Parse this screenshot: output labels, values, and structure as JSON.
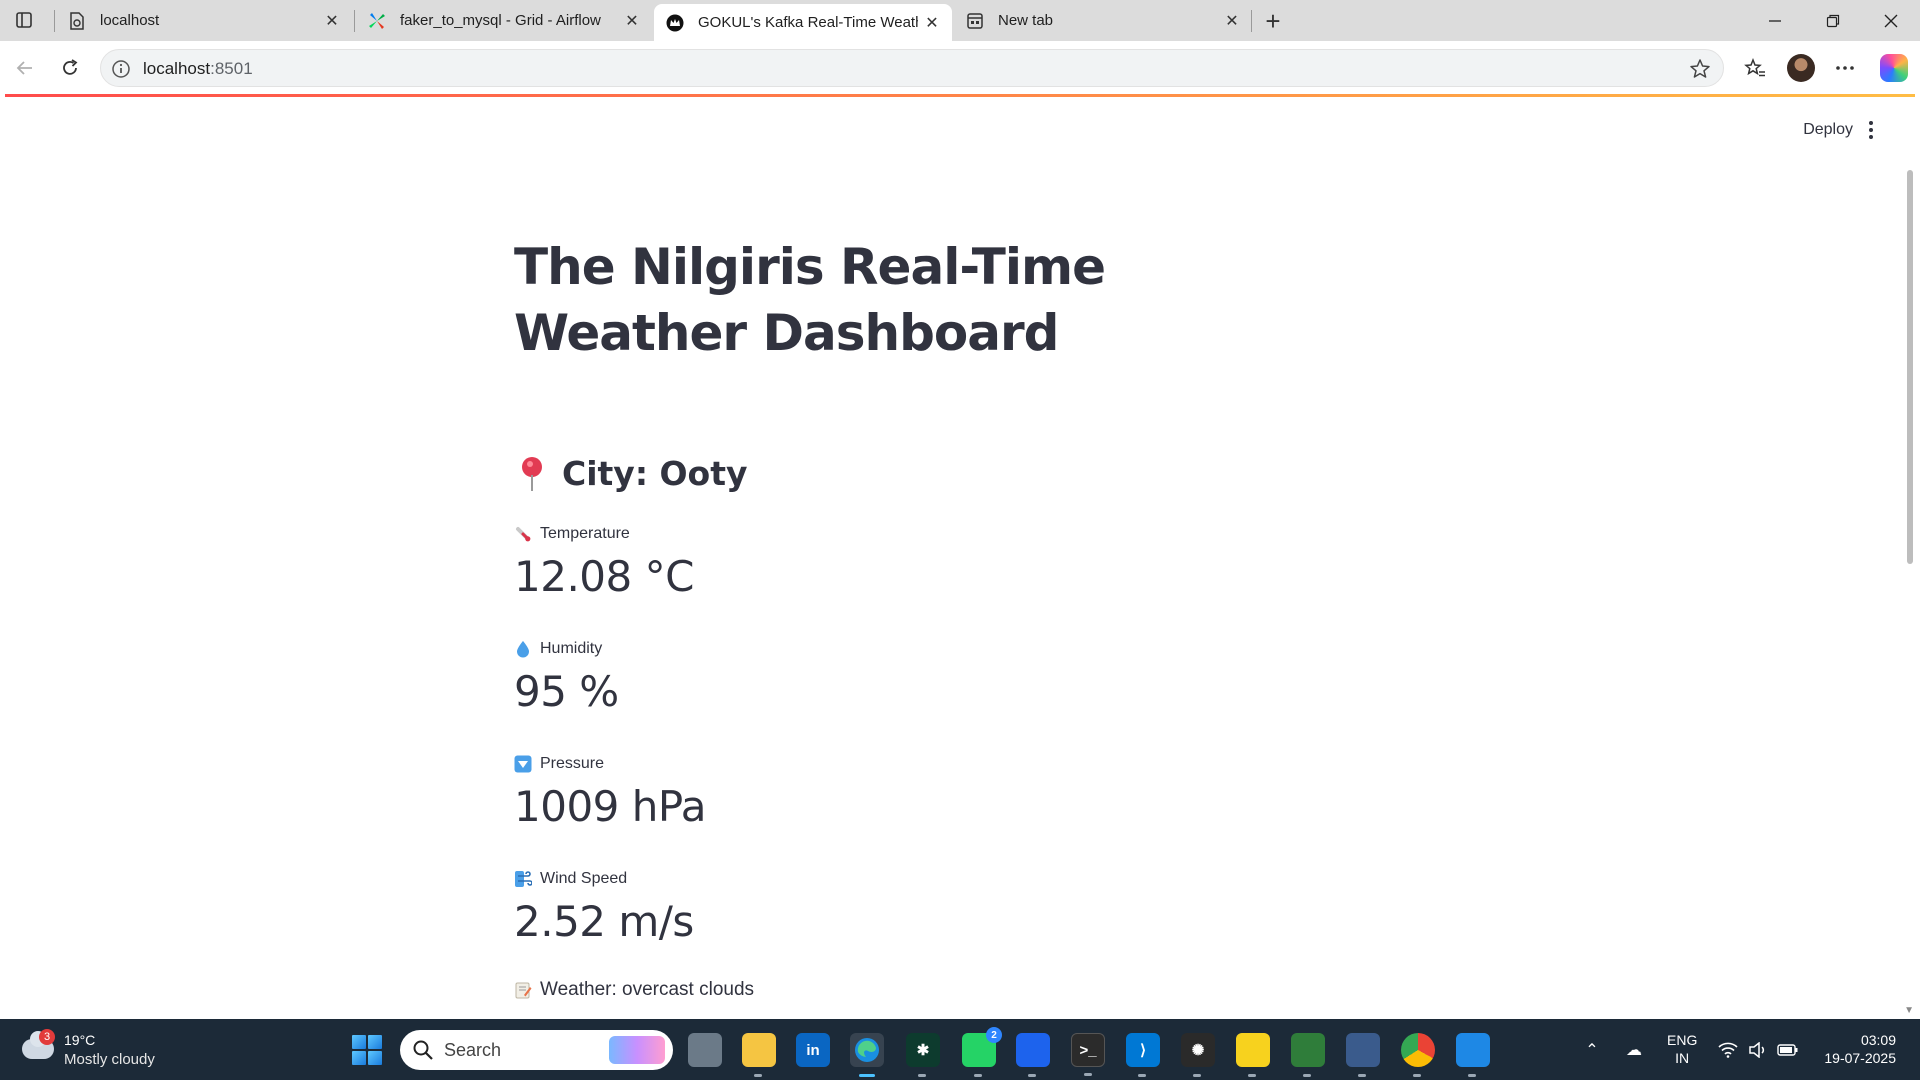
{
  "browser": {
    "tabs": [
      {
        "title": "localhost",
        "active": false
      },
      {
        "title": "faker_to_mysql - Grid - Airflow",
        "active": false
      },
      {
        "title": "GOKUL's Kafka Real-Time Weathe",
        "active": true
      },
      {
        "title": "New tab",
        "active": false
      }
    ],
    "address": {
      "host": "localhost",
      "port": ":8501"
    }
  },
  "app": {
    "deploy_label": "Deploy",
    "title": "The Nilgiris Real-Time Weather Dashboard",
    "city": "City: Ooty",
    "metrics": [
      {
        "label": "Temperature",
        "value": "12.08 °C",
        "icon": "thermometer-icon"
      },
      {
        "label": "Humidity",
        "value": "95 %",
        "icon": "droplet-icon"
      },
      {
        "label": "Pressure",
        "value": "1009 hPa",
        "icon": "down-arrow-icon"
      },
      {
        "label": "Wind Speed",
        "value": "2.52 m/s",
        "icon": "wind-icon"
      }
    ],
    "weather": "Weather: overcast clouds"
  },
  "taskbar": {
    "weather_temp": "19°C",
    "weather_desc": "Mostly cloudy",
    "weather_badge": "3",
    "search_placeholder": "Search",
    "whatsapp_badge": "2",
    "lang_line1": "ENG",
    "lang_line2": "IN",
    "time": "03:09",
    "date": "19-07-2025"
  },
  "colors": {
    "text": "#31333f",
    "accent_gradient_start": "#ff4b4b",
    "accent_gradient_end": "#ffbd45",
    "taskbar": "#1c2a38"
  }
}
